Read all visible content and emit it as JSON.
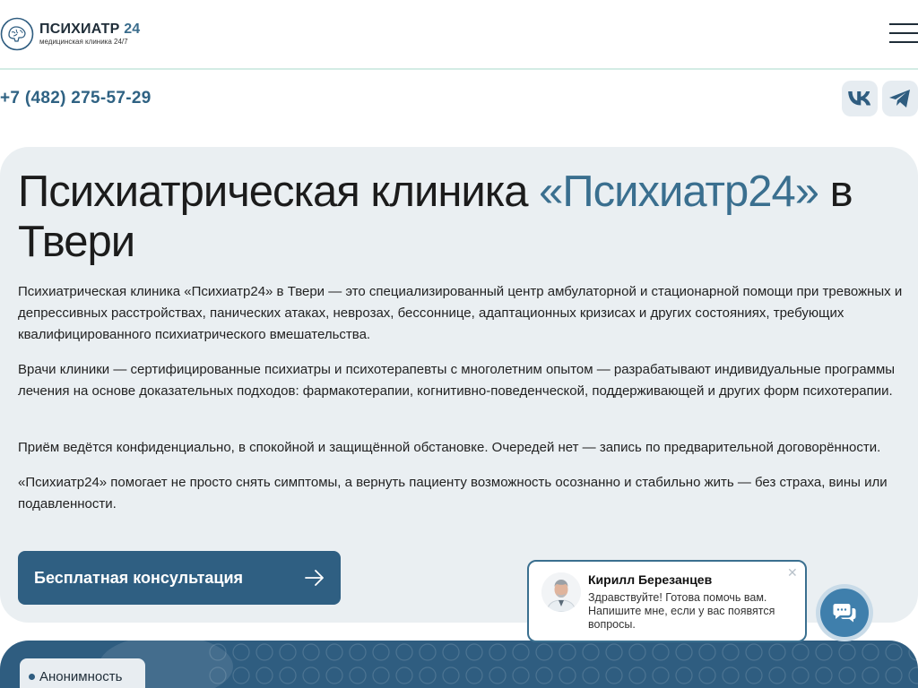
{
  "header": {
    "logo_name": "ПСИХИАТР",
    "logo_number": "24",
    "logo_subtitle": "медицинская клиника 24/7",
    "menu_icon": "hamburger-icon"
  },
  "contacts": {
    "phone": "+7 (482) 275-57-29",
    "socials": [
      {
        "icon": "vk-icon"
      },
      {
        "icon": "telegram-icon"
      }
    ]
  },
  "hero": {
    "title_before": "Психиатрическая клиника ",
    "title_accent": "«Психиатр24»",
    "title_after": " в Твери",
    "paragraphs": [
      "Психиатрическая клиника «Психиатр24» в Твери — это специализированный центр амбулаторной и стационарной помощи при тревожных и депрессивных расстройствах, панических атаках, неврозах, бессоннице, адаптационных кризисах и других состояниях, требующих квалифицированного психиатрического вмешательства.",
      "Врачи клиники — сертифицированные психиатры и психотерапевты с многолетним опытом — разрабатывают индивидуальные программы лечения на основе доказательных подходов: фармакотерапии, когнитивно-поведенческой, поддерживающей и других форм психотерапии.",
      "Приём ведётся конфиденциально, в спокойной и защищённой обстановке. Очередей нет — запись по предварительной договорённости.",
      "«Психиатр24» помогает не просто снять симптомы, а вернуть пациенту возможность осознанно и стабильно жить — без страха, вины или подавленности."
    ],
    "cta_label": "Бесплатная консультация",
    "cta_icon": "arrow-right-icon"
  },
  "banner": {
    "chip_label": "Анонимность"
  },
  "chat": {
    "name": "Кирилл Березанцев",
    "message": "Здравствуйте! Готова помочь вам. Напишите мне, если у вас появятся вопросы.",
    "close_icon": "close-icon",
    "button_icon": "chat-icon"
  },
  "colors": {
    "accent": "#3a6f8f",
    "primary_button": "#2f5f82",
    "hero_bg": "#eaeff2",
    "banner_bg": "#2f5d80"
  }
}
